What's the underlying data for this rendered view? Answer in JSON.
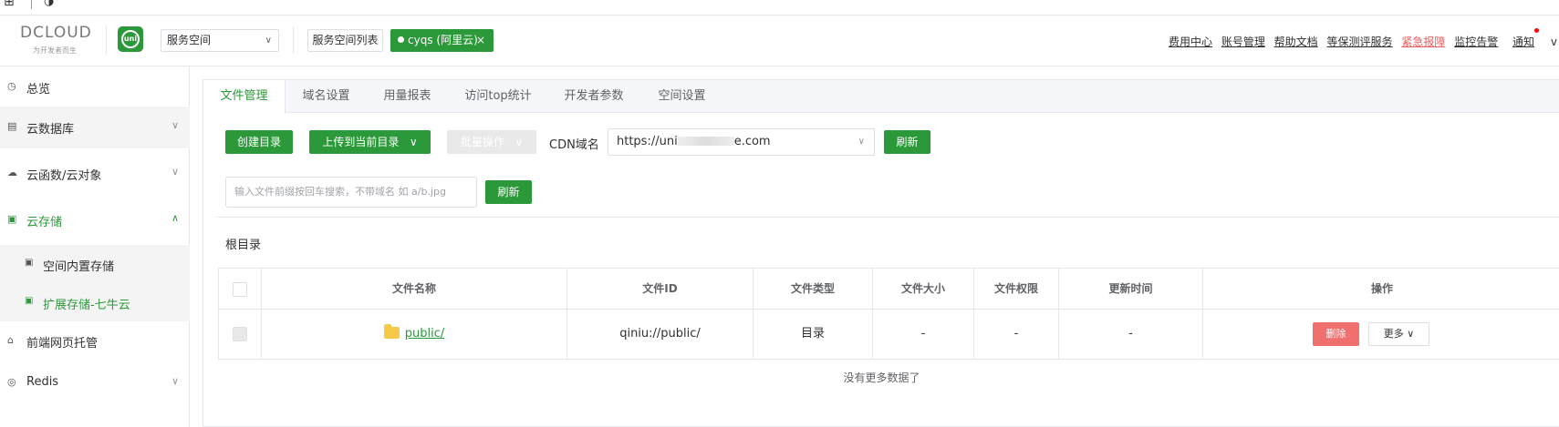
{
  "os": {
    "glyph1": "⊞",
    "glyph2": "◑"
  },
  "header": {
    "logo_text": "DCLOUD",
    "slogan": "为开发者而生",
    "uni_badge": "uni",
    "space_select_value": "服务空间",
    "space_list_label": "服务空间列表",
    "active_space_label": "cyqs (阿里云)",
    "close_glyph": "×",
    "links": [
      "费用中心",
      "账号管理",
      "帮助文档",
      "等保测评服务",
      "紧急报障",
      "监控告警"
    ],
    "notifications_label": "通知",
    "user_initial": "v"
  },
  "sidebar": {
    "items": [
      {
        "label": "总览",
        "icon": "dashboard-icon"
      },
      {
        "label": "云数据库",
        "icon": "database-icon"
      },
      {
        "label": "云函数/云对象",
        "icon": "cloud-icon"
      },
      {
        "label": "云存储",
        "icon": "storage-icon"
      },
      {
        "label": "前端网页托管",
        "icon": "hosting-icon"
      },
      {
        "label": "Redis",
        "icon": "redis-icon"
      }
    ],
    "sub_items": [
      {
        "label": "空间内置存储",
        "icon": "disk-icon"
      },
      {
        "label": "扩展存储-七牛云",
        "icon": "disk-icon"
      }
    ]
  },
  "tabs": [
    "文件管理",
    "域名设置",
    "用量报表",
    "访问top统计",
    "开发者参数",
    "空间设置"
  ],
  "toolbar": {
    "create_dir": "创建目录",
    "upload": "上传到当前目录",
    "batch": "批量操作",
    "cdn_label": "CDN域名",
    "cdn_prefix": "https://uni",
    "cdn_suffix": "e.com",
    "refresh": "刷新"
  },
  "search": {
    "placeholder": "输入文件前缀按回车搜索，不带域名 如 a/b.jpg",
    "refresh": "刷新"
  },
  "breadcrumb": "根目录",
  "table": {
    "columns": [
      "文件名称",
      "文件ID",
      "文件类型",
      "文件大小",
      "文件权限",
      "更新时间",
      "操作"
    ],
    "rows": [
      {
        "name": "public/",
        "id": "qiniu://public/",
        "type": "目录",
        "size": "-",
        "permission": "-",
        "updated": "-",
        "delete": "删除",
        "more": "更多"
      }
    ],
    "footer": "没有更多数据了"
  }
}
